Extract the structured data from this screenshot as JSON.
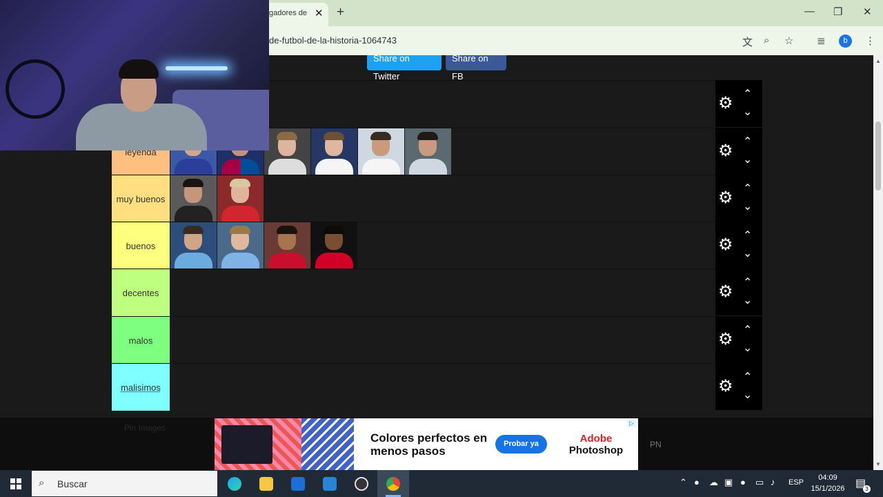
{
  "browser": {
    "tab_title": "gadores de",
    "tab_close": "✕",
    "new_tab": "+",
    "window_minimize": "—",
    "window_restore": "❐",
    "window_close": "✕",
    "url": "de-futbol-de-la-historia-1064743",
    "translate_icon": "文",
    "zoom_icon": "⌕",
    "star_icon": "☆",
    "media_icon": "≣",
    "profile_initial": "b",
    "menu_icon": "⋮"
  },
  "share": {
    "twitter": "Share on Twitter",
    "facebook": "Share on FB"
  },
  "tiers": [
    {
      "label": "",
      "color": "#1a1a1a"
    },
    {
      "label": "leyenda",
      "color": "#ffbf7f"
    },
    {
      "label": "muy buenos",
      "color": "#ffdf7f"
    },
    {
      "label": "buenos",
      "color": "#ffff7f"
    },
    {
      "label": "decentes",
      "color": "#bfff7f"
    },
    {
      "label": "malos",
      "color": "#7fff7f"
    },
    {
      "label": "malisimos",
      "color": "#7fffff"
    }
  ],
  "controls": {
    "gear_icon": "⚙",
    "up_icon": "⌃",
    "down_icon": "⌄"
  },
  "ad": {
    "headline": "Colores perfectos en menos pasos",
    "button": "Probar ya",
    "brand_line1": "Adobe",
    "brand_line2": "Photoshop",
    "info": "▷",
    "ghost_text": "Pin Images",
    "side_text": "PN"
  },
  "taskbar": {
    "search_placeholder": "Buscar",
    "language": "ESP",
    "time": "04:09",
    "date": "15/1/2026",
    "notification_count": "3"
  }
}
